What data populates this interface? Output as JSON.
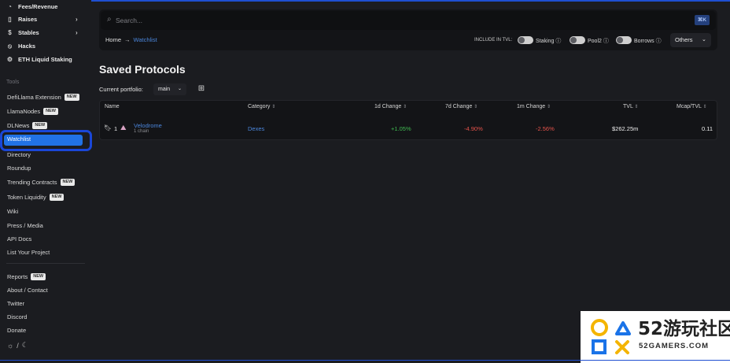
{
  "sidebar": {
    "top_items": [
      {
        "label": "Fees/Revenue",
        "icon": "fees-icon",
        "chevron": false
      },
      {
        "label": "Raises",
        "icon": "raises-icon",
        "chevron": true
      },
      {
        "label": "Stables",
        "icon": "stables-icon",
        "chevron": true
      },
      {
        "label": "Hacks",
        "icon": "hacks-icon",
        "chevron": false
      },
      {
        "label": "ETH Liquid Staking",
        "icon": "eth-staking-icon",
        "chevron": false
      }
    ],
    "tools_label": "Tools",
    "tools": [
      {
        "label": "DefiLlama Extension",
        "badge": "NEW"
      },
      {
        "label": "LlamaNodes",
        "badge": "NEW"
      },
      {
        "label": "DLNews",
        "badge": "NEW"
      },
      {
        "label": "Watchlist",
        "badge": ""
      },
      {
        "label": "Directory",
        "badge": ""
      },
      {
        "label": "Roundup",
        "badge": ""
      },
      {
        "label": "Trending Contracts",
        "badge": "NEW"
      },
      {
        "label": "Token Liquidity",
        "badge": "NEW"
      },
      {
        "label": "Wiki",
        "badge": ""
      },
      {
        "label": "Press / Media",
        "badge": ""
      },
      {
        "label": "API Docs",
        "badge": ""
      },
      {
        "label": "List Your Project",
        "badge": ""
      }
    ],
    "footer": [
      {
        "label": "Reports",
        "badge": "NEW"
      },
      {
        "label": "About / Contact",
        "badge": ""
      },
      {
        "label": "Twitter",
        "badge": ""
      },
      {
        "label": "Discord",
        "badge": ""
      },
      {
        "label": "Donate",
        "badge": ""
      }
    ],
    "theme_separator": "/"
  },
  "header": {
    "search_placeholder": "Search...",
    "shortcut": "⌘K",
    "breadcrumb_home": "Home",
    "breadcrumb_arrow": "→",
    "breadcrumb_current": "Watchlist",
    "include_label": "INCLUDE IN TVL:",
    "toggles": [
      "Staking",
      "Pool2",
      "Borrows"
    ],
    "others_label": "Others"
  },
  "main": {
    "title": "Saved Protocols",
    "portfolio_label": "Current portfolio:",
    "portfolio_value": "main",
    "columns": [
      "Name",
      "Category",
      "1d Change",
      "7d Change",
      "1m Change",
      "TVL",
      "Mcap/TVL"
    ],
    "rows": [
      {
        "rank": "1",
        "name": "Velodrome",
        "chains": "1 chain",
        "category": "Dexes",
        "change_1d": "+1.05%",
        "change_7d": "-4.90%",
        "change_1m": "-2.56%",
        "tvl": "$262.25m",
        "mcap_tvl": "0.11"
      }
    ]
  },
  "colors": {
    "accent": "#2172e5",
    "link": "#4b86db",
    "positive": "#3fb950",
    "negative": "#e5534b",
    "highlight_ring": "#1a47d8"
  },
  "watermark": {
    "number": "52游玩社区",
    "site": "52GAMERS.COM"
  }
}
